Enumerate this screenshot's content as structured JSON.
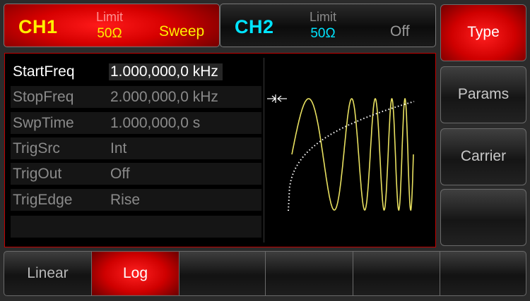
{
  "ch1": {
    "name": "CH1",
    "limit_label": "Limit",
    "impedance": "50Ω",
    "mode": "Sweep"
  },
  "ch2": {
    "name": "CH2",
    "limit_label": "Limit",
    "impedance": "50Ω",
    "mode": "Off"
  },
  "params": [
    {
      "name": "StartFreq",
      "value": "1.000,000,0 kHz",
      "selected": true
    },
    {
      "name": "StopFreq",
      "value": "2.000,000,0 kHz",
      "selected": false
    },
    {
      "name": "SwpTime",
      "value": "1.000,000,0 s",
      "selected": false
    },
    {
      "name": "TrigSrc",
      "value": "Int",
      "selected": false
    },
    {
      "name": "TrigOut",
      "value": "Off",
      "selected": false
    },
    {
      "name": "TrigEdge",
      "value": "Rise",
      "selected": false
    },
    {
      "name": "",
      "value": "",
      "selected": false
    }
  ],
  "side_menu": [
    "Type",
    "Params",
    "Carrier",
    ""
  ],
  "bottom_menu": [
    "Linear",
    "Log",
    "",
    "",
    "",
    ""
  ],
  "colors": {
    "ch1": "#fff000",
    "ch2": "#00e4ff",
    "active": "#d60000",
    "wave": "#e8e060"
  }
}
